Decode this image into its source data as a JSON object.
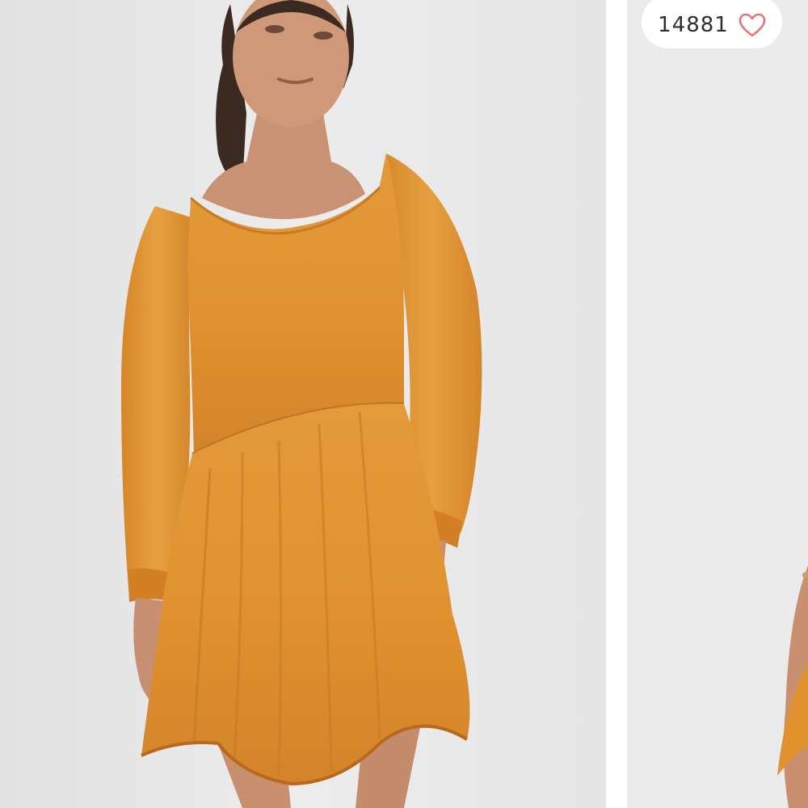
{
  "listing": {
    "likes": {
      "count": "14881",
      "icon": "heart-outline-icon",
      "icon_color": "#e87373"
    },
    "photos": {
      "background_color": "#e9e9e9",
      "garment_color": "#e0922f"
    }
  }
}
